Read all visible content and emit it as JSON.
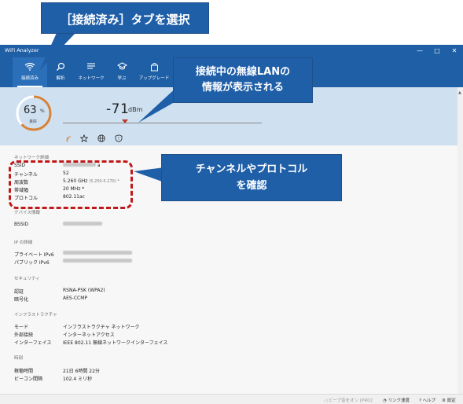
{
  "window": {
    "title": "WiFi Analyzer",
    "minimize": "—",
    "maximize": "□",
    "close": "✕"
  },
  "nav": {
    "tabs": [
      {
        "label": "接続済み",
        "icon": "wifi-icon"
      },
      {
        "label": "解析",
        "icon": "magnifier-icon"
      },
      {
        "label": "ネットワーク",
        "icon": "list-icon"
      },
      {
        "label": "学ぶ",
        "icon": "graduation-cap-icon"
      },
      {
        "label": "アップグレード",
        "icon": "shopping-bag-icon"
      }
    ]
  },
  "signal": {
    "quality_value": "63",
    "quality_unit": "%",
    "quality_label": "良好",
    "quality_fraction": 0.63,
    "dbm_value": "-71",
    "dbm_unit": "dBm",
    "icons": [
      "signal-icon",
      "star-icon",
      "globe-icon",
      "shield-icon"
    ],
    "colors": {
      "ring": "#d6833a",
      "marker": "#c0392b",
      "band": "#cfe0f0"
    }
  },
  "network_details": {
    "heading": "ネットワーク詳細",
    "rows": [
      {
        "label": "SSID",
        "value": "a",
        "blurred": true
      },
      {
        "label": "チャンネル",
        "value": "52"
      },
      {
        "label": "周波数",
        "value": "5.260 GHz",
        "sub": "(5.250-5.270) *"
      },
      {
        "label": "帯域幅",
        "value": "20 MHz *"
      },
      {
        "label": "プロトコル",
        "value": "802.11ac"
      }
    ]
  },
  "device_info": {
    "heading": "デバイス情報",
    "rows": [
      {
        "label": "BSSID",
        "blurred": true
      }
    ]
  },
  "ip_details": {
    "heading": "IP の詳細",
    "rows": [
      {
        "label": "プライベート IPv6",
        "blurred": true
      },
      {
        "label": "パブリック IPv6",
        "blurred": true
      }
    ]
  },
  "security": {
    "heading": "セキュリティ",
    "rows": [
      {
        "label": "認証",
        "value": "RSNA-PSK (WPA2)"
      },
      {
        "label": "暗号化",
        "value": "AES-CCMP"
      }
    ]
  },
  "infrastructure": {
    "heading": "インフラストラクチャ",
    "rows": [
      {
        "label": "モード",
        "value": "インフラストラクチャ ネットワーク"
      },
      {
        "label": "外部接続",
        "value": "インターネットアクセス"
      },
      {
        "label": "インターフェイス",
        "value": "IEEE 802.11 無線ネットワークインターフェイス"
      }
    ]
  },
  "time": {
    "heading": "時刻",
    "rows": [
      {
        "label": "稼働時間",
        "value": "21日 6時間 22分"
      },
      {
        "label": "ビーコン間隔",
        "value": "102.4 ミリ秒"
      }
    ]
  },
  "statusbar": {
    "beep": "ビープ音をオン [PRO]",
    "link_speed": "リンク速度",
    "help": "ヘルプ",
    "settings": "設定"
  },
  "callouts": {
    "tab": "［接続済み］タブを選択",
    "info_line1": "接続中の無線LANの",
    "info_line2": "情報が表示される",
    "channel_line1": "チャンネルやプロトコル",
    "channel_line2": "を確認"
  }
}
